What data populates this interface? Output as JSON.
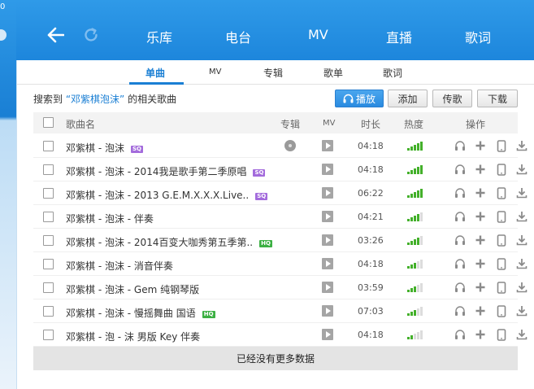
{
  "colors": {
    "accent": "#1a7fd4",
    "topbar": "#2590e3",
    "heat_on": "#43b02a",
    "heat_off": "#dcdcdc",
    "sq_badge": "#a36bdc",
    "hq_badge": "#3cb043"
  },
  "edge_char": "0",
  "nav": {
    "back_icon": "back-arrow-icon",
    "refresh_icon": "refresh-icon",
    "tabs": [
      "乐库",
      "电台",
      "MV",
      "直播",
      "歌词"
    ]
  },
  "subtabs": [
    "单曲",
    "MV",
    "专辑",
    "歌单",
    "歌词"
  ],
  "search": {
    "prefix": "搜索到",
    "keyword": "“邓紫棋泡沫”",
    "suffix": "的相关歌曲"
  },
  "buttons": {
    "play": "播放",
    "add": "添加",
    "send": "传歌",
    "download": "下载"
  },
  "columns": {
    "name": "歌曲名",
    "album": "专辑",
    "mv": "MV",
    "duration": "时长",
    "heat": "热度",
    "ops": "操作"
  },
  "songs": [
    {
      "name": "邓紫棋 - 泡沫",
      "badge": "SQ",
      "album_icon": true,
      "duration": "04:18",
      "heat": 5
    },
    {
      "name": "邓紫棋 - 泡沫 - 2014我是歌手第二季原唱",
      "badge": "SQ",
      "album_icon": false,
      "duration": "04:18",
      "heat": 5
    },
    {
      "name": "邓紫棋 - 泡沫 - 2013 G.E.M.X.X.X.Live..",
      "badge": "SQ",
      "album_icon": false,
      "duration": "06:22",
      "heat": 5
    },
    {
      "name": "邓紫棋 - 泡沫 - 伴奏",
      "badge": "",
      "album_icon": false,
      "duration": "04:21",
      "heat": 4
    },
    {
      "name": "邓紫棋 - 泡沫 - 2014百变大咖秀第五季第..",
      "badge": "HQ",
      "album_icon": false,
      "duration": "03:26",
      "heat": 4
    },
    {
      "name": "邓紫棋 - 泡沫 - 消音伴奏",
      "badge": "",
      "album_icon": false,
      "duration": "04:18",
      "heat": 3
    },
    {
      "name": "邓紫棋 - 泡沫 - Gem 纯钢琴版",
      "badge": "",
      "album_icon": false,
      "duration": "03:59",
      "heat": 3
    },
    {
      "name": "邓紫棋 - 泡沫 - 慢摇舞曲 国语",
      "badge": "HQ",
      "album_icon": false,
      "duration": "07:03",
      "heat": 3
    },
    {
      "name": "邓紫棋 - 泡 - 沫 男版 Key 伴奏",
      "badge": "",
      "album_icon": false,
      "duration": "04:18",
      "heat": 2
    }
  ],
  "op_icons": [
    "headphones-icon",
    "plus-icon",
    "phone-icon",
    "download-icon"
  ],
  "footer": "已经没有更多数据"
}
